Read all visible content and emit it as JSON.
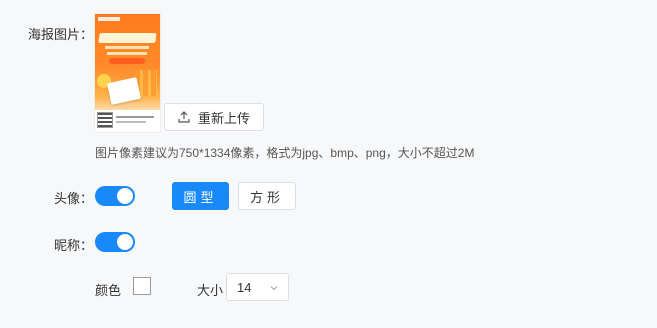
{
  "poster": {
    "label": "海报图片：",
    "reupload_label": "重新上传",
    "hint": "图片像素建议为750*1334像素，格式为jpg、bmp、png，大小不超过2M"
  },
  "avatar": {
    "label": "头像：",
    "enabled": true,
    "shape_options": [
      "圆型",
      "方形"
    ],
    "selected_shape": "圆型"
  },
  "nickname": {
    "label": "昵称：",
    "enabled": true,
    "color_label": "颜色",
    "color_value": "#ffffff",
    "size_label": "大小",
    "size_value": "14"
  },
  "colors": {
    "accent": "#1989fa",
    "poster_orange": "#ff7a1a"
  },
  "icons": {
    "upload": "upload-icon",
    "chevron": "chevron-down-icon"
  }
}
